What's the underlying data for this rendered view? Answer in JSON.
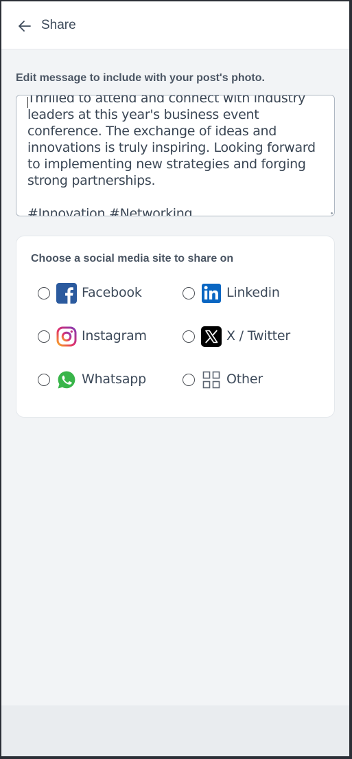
{
  "header": {
    "title": "Share",
    "back_icon": "arrow-left-icon"
  },
  "message": {
    "label": "Edit message to include with your post's photo.",
    "text": "Thrilled to attend and connect with industry leaders at this year's business event conference. The exchange of ideas and innovations is truly inspiring. Looking forward to implementing new strategies and forging strong partnerships.\n\n#Innovation #Networking #BusinessConference"
  },
  "share": {
    "heading": "Choose a social media site to share on",
    "options": [
      {
        "label": "Facebook",
        "icon": "facebook-icon",
        "selected": false
      },
      {
        "label": "Linkedin",
        "icon": "linkedin-icon",
        "selected": false
      },
      {
        "label": "Instagram",
        "icon": "instagram-icon",
        "selected": false
      },
      {
        "label": "X / Twitter",
        "icon": "x-twitter-icon",
        "selected": false
      },
      {
        "label": "Whatsapp",
        "icon": "whatsapp-icon",
        "selected": false
      },
      {
        "label": "Other",
        "icon": "grid-icon",
        "selected": false
      }
    ]
  },
  "colors": {
    "facebook": "#2b5a9e",
    "linkedin": "#0a66c2",
    "whatsapp": "#39b54a",
    "x": "#000000",
    "text": "#3d4a5a",
    "background": "#f2f4f6"
  }
}
